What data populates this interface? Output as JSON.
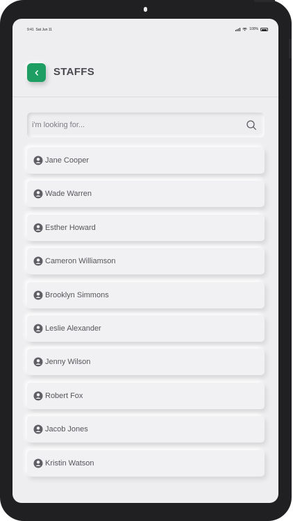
{
  "status_bar": {
    "time": "9:41",
    "date": "Sat Jun 11",
    "battery": "100%"
  },
  "header": {
    "title": "STAFFS",
    "back_icon": "chevron-left-icon",
    "accent_color": "#1f9e63"
  },
  "search": {
    "placeholder": "i'm looking for...",
    "value": "",
    "icon": "search-icon"
  },
  "staff": [
    {
      "name": "Jane Cooper"
    },
    {
      "name": "Wade Warren"
    },
    {
      "name": "Esther Howard"
    },
    {
      "name": "Cameron Williamson"
    },
    {
      "name": "Brooklyn Simmons"
    },
    {
      "name": "Leslie Alexander"
    },
    {
      "name": "Jenny Wilson"
    },
    {
      "name": "Robert Fox"
    },
    {
      "name": "Jacob Jones"
    },
    {
      "name": "Kristin Watson"
    }
  ]
}
